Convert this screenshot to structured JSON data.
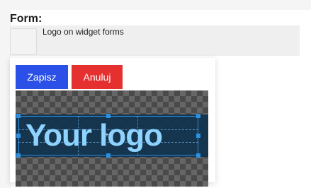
{
  "form": {
    "title": "Form:",
    "setting_label": "Logo on widget forms"
  },
  "actions": {
    "save_label": "Zapisz",
    "cancel_label": "Anuluj"
  },
  "preview": {
    "logo_text": "Your logo"
  },
  "colors": {
    "save": "#2b50e8",
    "cancel": "#e53030",
    "selection": "#2c8fe0"
  }
}
